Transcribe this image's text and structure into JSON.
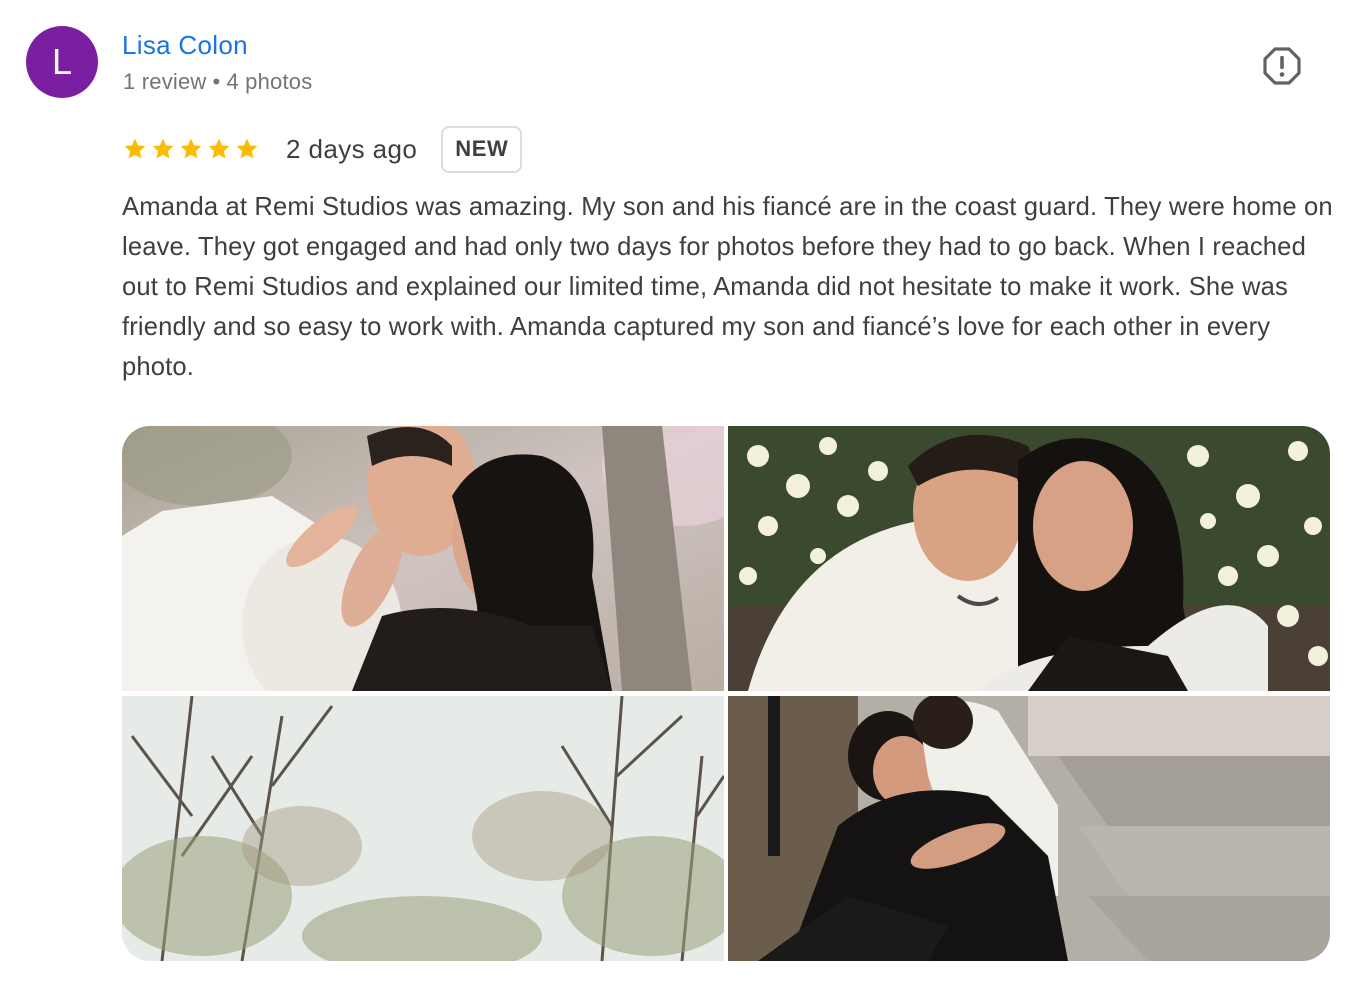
{
  "author": {
    "avatar_letter": "L",
    "avatar_color": "#7b1fa2",
    "name": "Lisa Colon",
    "review_count": "1 review",
    "separator": "•",
    "photo_count": "4 photos"
  },
  "review": {
    "rating": 5,
    "date": "2 days ago",
    "badge": "NEW",
    "text": "Amanda at Remi Studios was amazing. My son and his fiancé are in the coast guard. They were home on leave. They got engaged and had only two days for photos before they had to go back. When I reached out to Remi Studios and explained our limited time, Amanda did not hesitate to make it work. She was friendly and so easy to work with. Amanda captured my son and fiancé’s love for each other in every photo."
  },
  "icons": {
    "report": "report-flag-icon",
    "star": "star-icon"
  },
  "colors": {
    "name_link": "#1a73e8",
    "star": "#fbbc04",
    "meta": "#70757a",
    "text": "#3c4043"
  },
  "photos": [
    {
      "subject": "couple kissing near tree"
    },
    {
      "subject": "couple smiling among daffodils"
    },
    {
      "subject": "bare trees against sky"
    },
    {
      "subject": "couple embracing on steps"
    }
  ]
}
